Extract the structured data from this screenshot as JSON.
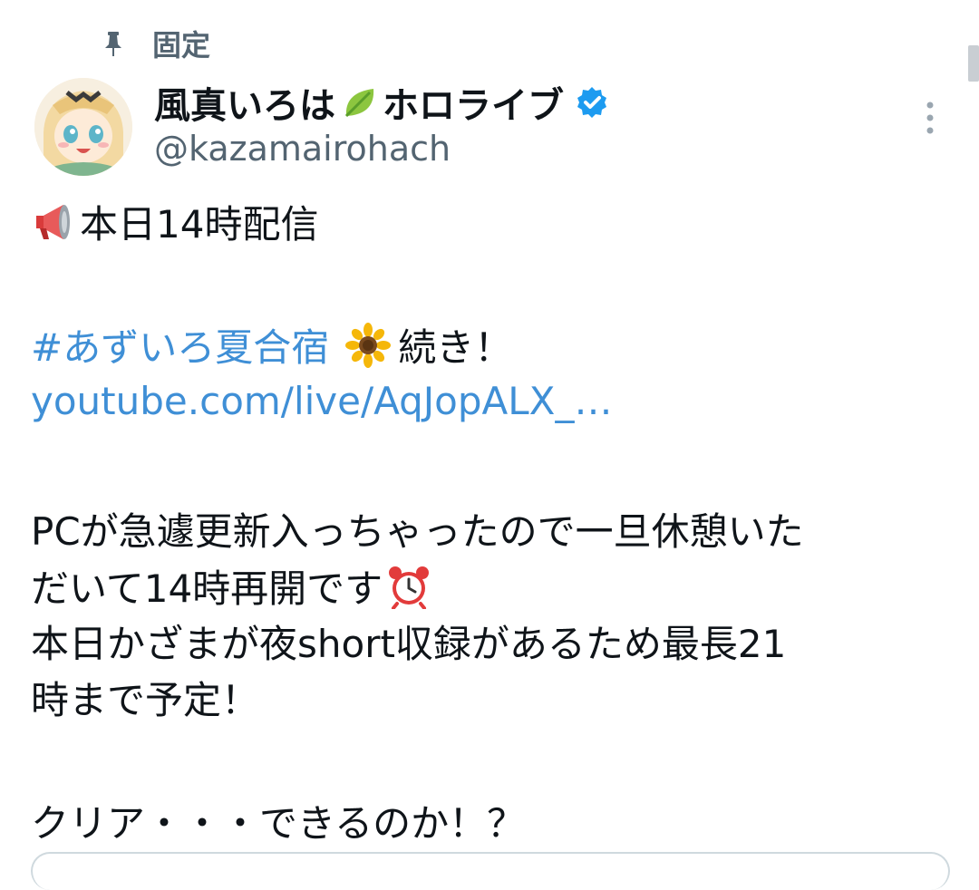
{
  "pinned": {
    "label": "固定"
  },
  "author": {
    "display_name": "風真いろは",
    "display_name_suffix": "ホロライブ",
    "handle": "@kazamairohach"
  },
  "tweet": {
    "line1": "本日14時配信",
    "hashtag": "#あずいろ夏合宿",
    "line2_rest": "続き！",
    "link": "youtube.com/live/AqJopALX_…",
    "line4": "PCが急遽更新入っちゃったので一旦休憩いた",
    "line5": "だいて14時再開です",
    "line6": "本日かざまが夜short収録があるため最長21",
    "line7": "時まで予定！",
    "line8": "クリア・・・できるのか！？"
  },
  "icons": {
    "pin": "pin-icon",
    "verified": "verified-badge-icon",
    "more": "more-vertical-icon",
    "megaphone": "megaphone-emoji",
    "leaf": "leaf-emoji",
    "sunflower": "sunflower-emoji",
    "alarm": "alarm-clock-emoji"
  },
  "colors": {
    "link": "#3f8fd6",
    "secondary_text": "#536471",
    "verified": "#1d9bf0"
  }
}
